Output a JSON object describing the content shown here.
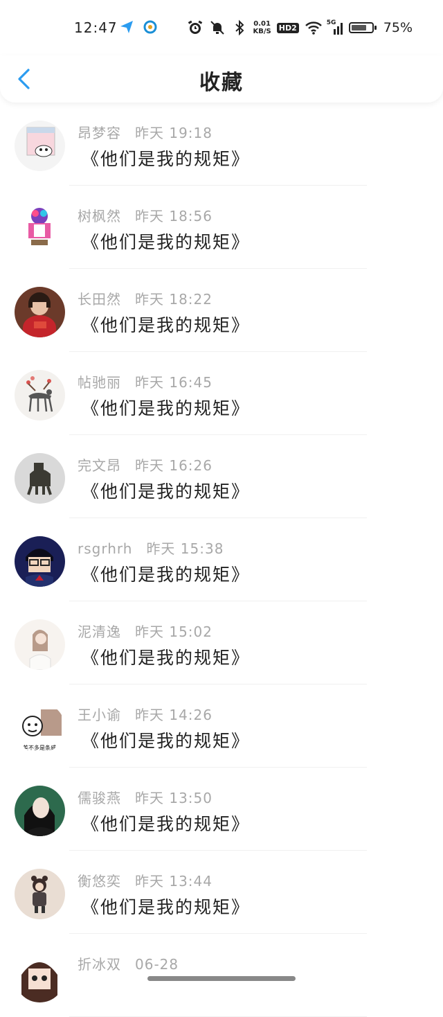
{
  "status_bar": {
    "time": "12:47",
    "net_rate_value": "0.01",
    "net_rate_unit": "KB/S",
    "hd_label": "HD2",
    "signal_label": "5G",
    "battery_percent": "75%",
    "battery_level": 0.75
  },
  "header": {
    "title": "收藏"
  },
  "items": [
    {
      "name": "昂梦容",
      "time": "昨天 19:18",
      "content": "《他们是我的规矩》",
      "avatar": "photo-frame"
    },
    {
      "name": "树枫然",
      "time": "昨天 18:56",
      "content": "《他们是我的规矩》",
      "avatar": "figure-pink"
    },
    {
      "name": "长田然",
      "time": "昨天 18:22",
      "content": "《他们是我的规矩》",
      "avatar": "girl-red"
    },
    {
      "name": "帖驰丽",
      "time": "昨天 16:45",
      "content": "《他们是我的规矩》",
      "avatar": "deer"
    },
    {
      "name": "完文昂",
      "time": "昨天 16:26",
      "content": "《他们是我的规矩》",
      "avatar": "bronze"
    },
    {
      "name": "rsgrhrh",
      "time": "昨天 15:38",
      "content": "《他们是我的规矩》",
      "avatar": "anime-boy"
    },
    {
      "name": "泥清逸",
      "time": "昨天 15:02",
      "content": "《他们是我的规矩》",
      "avatar": "girl-sketch"
    },
    {
      "name": "王小谕",
      "time": "昨天 14:26",
      "content": "《他们是我的规矩》",
      "avatar": "meme",
      "avatar_caption": "差不多是条咸"
    },
    {
      "name": "儒骏燕",
      "time": "昨天 13:50",
      "content": "《他们是我的规矩》",
      "avatar": "woman-dark"
    },
    {
      "name": "衡悠奕",
      "time": "昨天 13:44",
      "content": "《他们是我的规矩》",
      "avatar": "child"
    },
    {
      "name": "折冰双",
      "time": "06-28",
      "content": "",
      "avatar": "anime-girl"
    }
  ]
}
